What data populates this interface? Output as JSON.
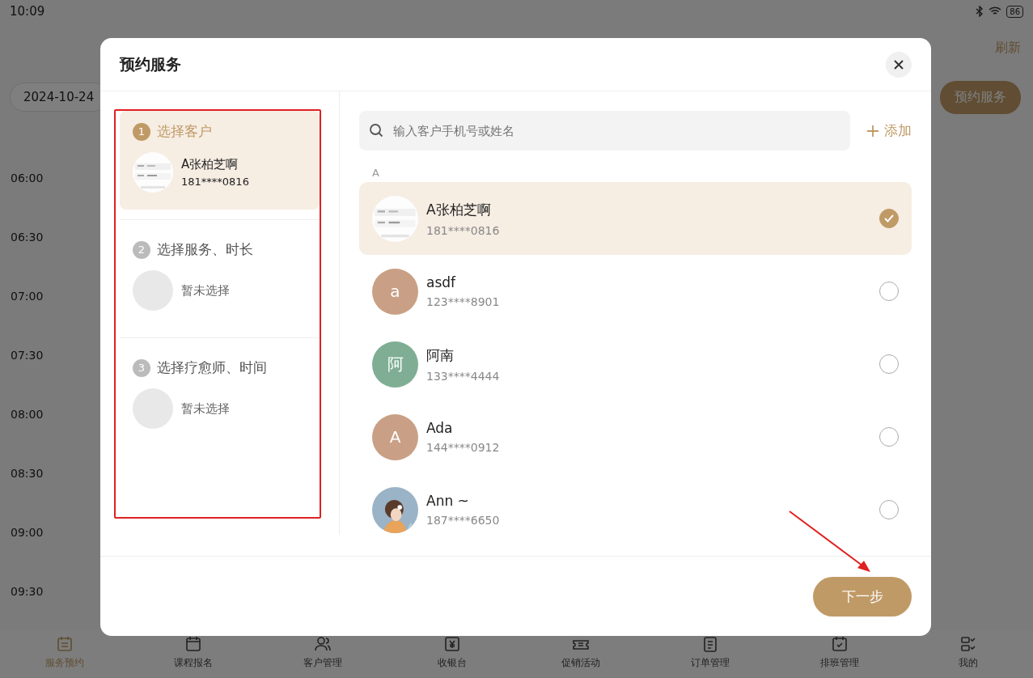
{
  "status_bar": {
    "time": "10:09",
    "battery": "86"
  },
  "page": {
    "refresh": "刷新",
    "date": "2024-10-24",
    "book_button": "预约服务",
    "times": [
      "06:00",
      "06:30",
      "07:00",
      "07:30",
      "08:00",
      "08:30",
      "09:00",
      "09:30"
    ]
  },
  "bottom_nav": [
    {
      "label": "服务预约",
      "selected": true
    },
    {
      "label": "课程报名",
      "selected": false
    },
    {
      "label": "客户管理",
      "selected": false
    },
    {
      "label": "收银台",
      "selected": false
    },
    {
      "label": "促销活动",
      "selected": false
    },
    {
      "label": "订单管理",
      "selected": false
    },
    {
      "label": "排班管理",
      "selected": false
    },
    {
      "label": "我的",
      "selected": false
    }
  ],
  "dialog": {
    "title": "预约服务",
    "steps": [
      {
        "number": "1",
        "title": "选择客户",
        "active": true,
        "summary": {
          "kind": "customer",
          "name": "A张柏芝啊",
          "phone": "181****0816"
        }
      },
      {
        "number": "2",
        "title": "选择服务、时长",
        "active": false,
        "summary": {
          "kind": "empty",
          "text": "暂未选择"
        }
      },
      {
        "number": "3",
        "title": "选择疗愈师、时间",
        "active": false,
        "summary": {
          "kind": "empty",
          "text": "暂未选择"
        }
      }
    ],
    "search": {
      "placeholder": "输入客户手机号或姓名"
    },
    "add": "添加",
    "section": "A",
    "customers": [
      {
        "name": "A张柏芝啊",
        "phone": "181****0816",
        "selected": true
      },
      {
        "name": "asdf",
        "phone": "123****8901",
        "avatar": {
          "kind": "letter",
          "text": "a",
          "color": "#c9a085"
        },
        "selected": false
      },
      {
        "name": "阿南",
        "phone": "133****4444",
        "avatar": {
          "kind": "letter",
          "text": "阿",
          "color": "#7fae94"
        },
        "selected": false
      },
      {
        "name": "Ada",
        "phone": "144****0912",
        "avatar": {
          "kind": "letter",
          "text": "A",
          "color": "#c9a085"
        },
        "selected": false
      },
      {
        "name": "Ann ~",
        "phone": "187****6650",
        "selected": false
      }
    ],
    "next": "下一步"
  }
}
